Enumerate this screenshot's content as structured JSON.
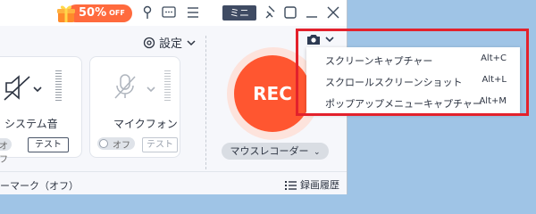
{
  "titlebar": {
    "promo_text": "50%",
    "promo_suffix": "OFF",
    "mini_label": "ミニ",
    "icons": [
      "gift-icon",
      "pin-icon",
      "chat-icon",
      "menu-icon",
      "pin-window-icon",
      "window-icon",
      "minimize-icon",
      "close-icon"
    ]
  },
  "settings": {
    "label": "設定"
  },
  "system_audio": {
    "label": "システム音",
    "toggle_label": "オフ",
    "test_label": "テスト"
  },
  "microphone": {
    "label": "マイクフォン",
    "toggle_label": "オフ",
    "test_label": "テスト"
  },
  "rec": {
    "label": "REC"
  },
  "mouse_recorder": {
    "label": "マウスレコーダー"
  },
  "footer": {
    "watermark_label": "ーマーク（オフ）",
    "history_label": "録画履歴"
  },
  "capture_menu": {
    "items": [
      {
        "label": "スクリーンキャプチャー",
        "shortcut": "Alt+C"
      },
      {
        "label": "スクロールスクリーンショット",
        "shortcut": "Alt+L"
      },
      {
        "label": "ポップアップメニューキャプチャー",
        "shortcut": "Alt+M"
      }
    ]
  },
  "colors": {
    "accent": "#ff5630",
    "highlight": "#e3212c",
    "desktop": "#9fc4e6"
  }
}
